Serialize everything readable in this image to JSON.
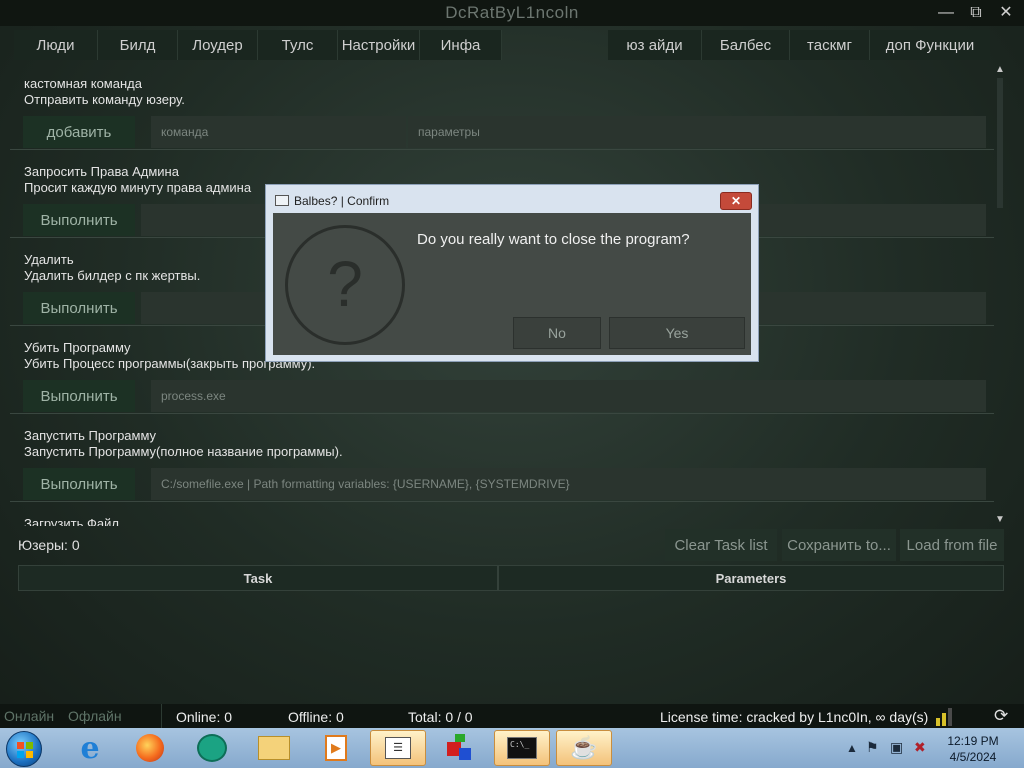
{
  "window": {
    "title": "DcRatByL1ncoln",
    "minimize": "—",
    "maximize": "⧉",
    "close": "✕"
  },
  "menu": [
    {
      "label": "Люди"
    },
    {
      "label": "Билд"
    },
    {
      "label": "Лоудер"
    },
    {
      "label": "Тулс"
    },
    {
      "label": "Настройки"
    },
    {
      "label": "Инфа"
    },
    {
      "label": ""
    },
    {
      "label": "юз айди"
    },
    {
      "label": "Балбес"
    },
    {
      "label": "таскмг"
    },
    {
      "label": "доп Функции"
    }
  ],
  "sections": [
    {
      "title": "кастомная команда",
      "desc": "Отправить команду юзеру.",
      "button": "добавить",
      "field1": "команда",
      "field2": "параметры"
    },
    {
      "title": "Запросить Права Админа",
      "desc": "Просит каждую минуту права админа",
      "button": "Выполнить"
    },
    {
      "title": "Удалить",
      "desc": "Удалить билдер с пк жертвы.",
      "button": "Выполнить"
    },
    {
      "title": "Убить Программу",
      "desc": "Убить Процесс программы(закрыть программу).",
      "button": "Выполнить",
      "field1": "process.exe"
    },
    {
      "title": "Запустить Программу",
      "desc": "Запустить Программу(полное название программы).",
      "button": "Выполнить",
      "field1": "C:/somefile.exe  | Path formatting variables: {USERNAME}, {SYSTEMDRIVE}"
    },
    {
      "title": "Загрузить Файл"
    }
  ],
  "users_label": "Юзеры: 0",
  "actions": {
    "clear": "Clear Task list",
    "save": "Сохранить to...",
    "load": "Load from file"
  },
  "table": {
    "columns": [
      "Task",
      "Parameters"
    ]
  },
  "status": {
    "online_tab": "Онлайн",
    "offline_tab": "Офлайн",
    "online": "Online: 0",
    "offline": "Offline: 0",
    "total": "Total: 0 / 0",
    "license": "License time: cracked by L1nc0In, ∞ day(s)"
  },
  "dialog": {
    "title": "Balbes? | Confirm",
    "close": "✕",
    "icon": "?",
    "message": "Do you really want to close the program?",
    "no": "No",
    "yes": "Yes"
  },
  "taskbar": {
    "apps": [
      "internet-explorer-icon",
      "firefox-icon",
      "chat-app-icon",
      "file-explorer-icon",
      "media-player-icon",
      "notepad-icon",
      "app-builder-icon",
      "cmd-icon",
      "java-icon"
    ],
    "clock_time": "12:19 PM",
    "clock_date": "4/5/2024"
  },
  "colors": {
    "accent": "#1c3124",
    "background": "#1d2a23",
    "dialog_frame": "#d9e3ef",
    "close_red": "#c44a3a"
  }
}
